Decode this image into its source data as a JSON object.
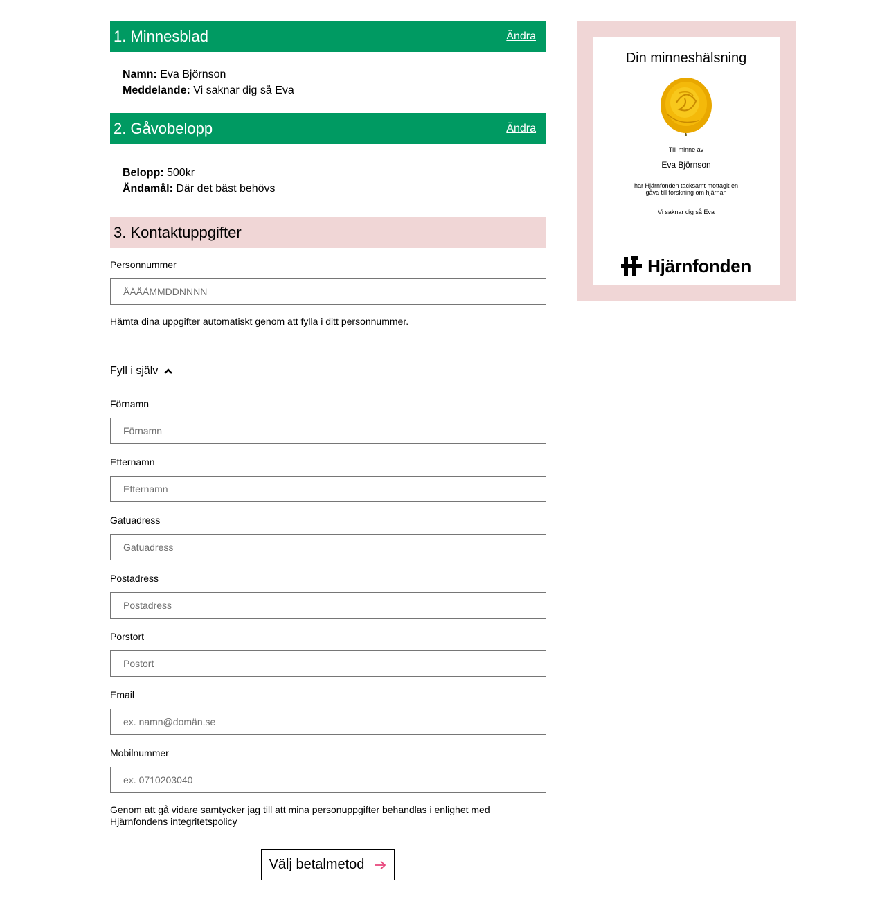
{
  "step1": {
    "title": "1. Minnesblad",
    "change_label": "Ändra",
    "name_label": "Namn:",
    "name_value": "Eva Björnson",
    "message_label": "Meddelande:",
    "message_value": "Vi saknar dig så Eva"
  },
  "step2": {
    "title": "2. Gåvobelopp",
    "change_label": "Ändra",
    "amount_label": "Belopp:",
    "amount_value": "500kr",
    "purpose_label": "Ändamål:",
    "purpose_value": "Där det bäst behövs"
  },
  "step3": {
    "title": "3. Kontaktuppgifter",
    "personnummer": {
      "label": "Personnummer",
      "placeholder": "ÅÅÅÅMMDDNNNN"
    },
    "hint": "Hämta dina uppgifter automatiskt genom att fylla i ditt personnummer.",
    "toggle_label": "Fyll i själv",
    "fields": [
      {
        "label": "Förnamn",
        "placeholder": "Förnamn"
      },
      {
        "label": "Efternamn",
        "placeholder": "Efternamn"
      },
      {
        "label": "Gatuadress",
        "placeholder": "Gatuadress"
      },
      {
        "label": "Postadress",
        "placeholder": "Postadress"
      },
      {
        "label": "Porstort",
        "placeholder": "Postort"
      },
      {
        "label": "Email",
        "placeholder": "ex. namn@domän.se"
      },
      {
        "label": "Mobilnummer",
        "placeholder": "ex. 0710203040"
      }
    ],
    "consent": "Genom att gå vidare samtycker jag till att mina personuppgifter behandlas i enlighet med Hjärnfondens integritetspolicy",
    "submit_label": "Välj betalmetod"
  },
  "preview": {
    "title": "Din minneshälsning",
    "in_memory": "Till minne av",
    "name": "Eva Björnson",
    "text_line1": "har Hjärnfonden tacksamt mottagit en",
    "text_line2": "gåva till forskning om hjärnan",
    "message": "Vi saknar dig så Eva",
    "logo_text": "Hjärnfonden"
  },
  "colors": {
    "green": "#009a62",
    "pink": "#f0d6d6",
    "arrow": "#e8457b",
    "rose": "#f2b705"
  }
}
